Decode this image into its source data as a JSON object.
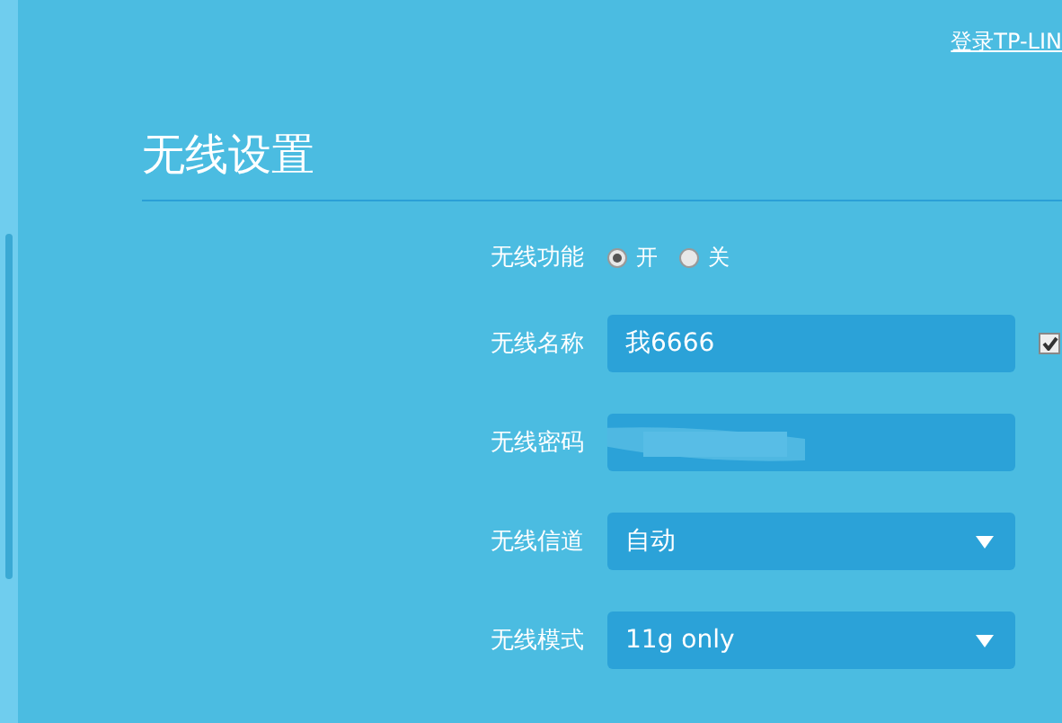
{
  "header_link": "登录TP-LIN",
  "title": "无线设置",
  "rows": [
    {
      "kind": "radio",
      "label": "无线功能",
      "options": [
        {
          "label": "开",
          "selected": true
        },
        {
          "label": "关",
          "selected": false
        }
      ]
    },
    {
      "kind": "text",
      "label": "无线名称",
      "value": "我6666",
      "checkbox": {
        "checked": true
      }
    },
    {
      "kind": "password",
      "label": "无线密码"
    },
    {
      "kind": "select",
      "label": "无线信道",
      "value": "自动"
    },
    {
      "kind": "select",
      "label": "无线模式",
      "value": "11g only"
    }
  ]
}
